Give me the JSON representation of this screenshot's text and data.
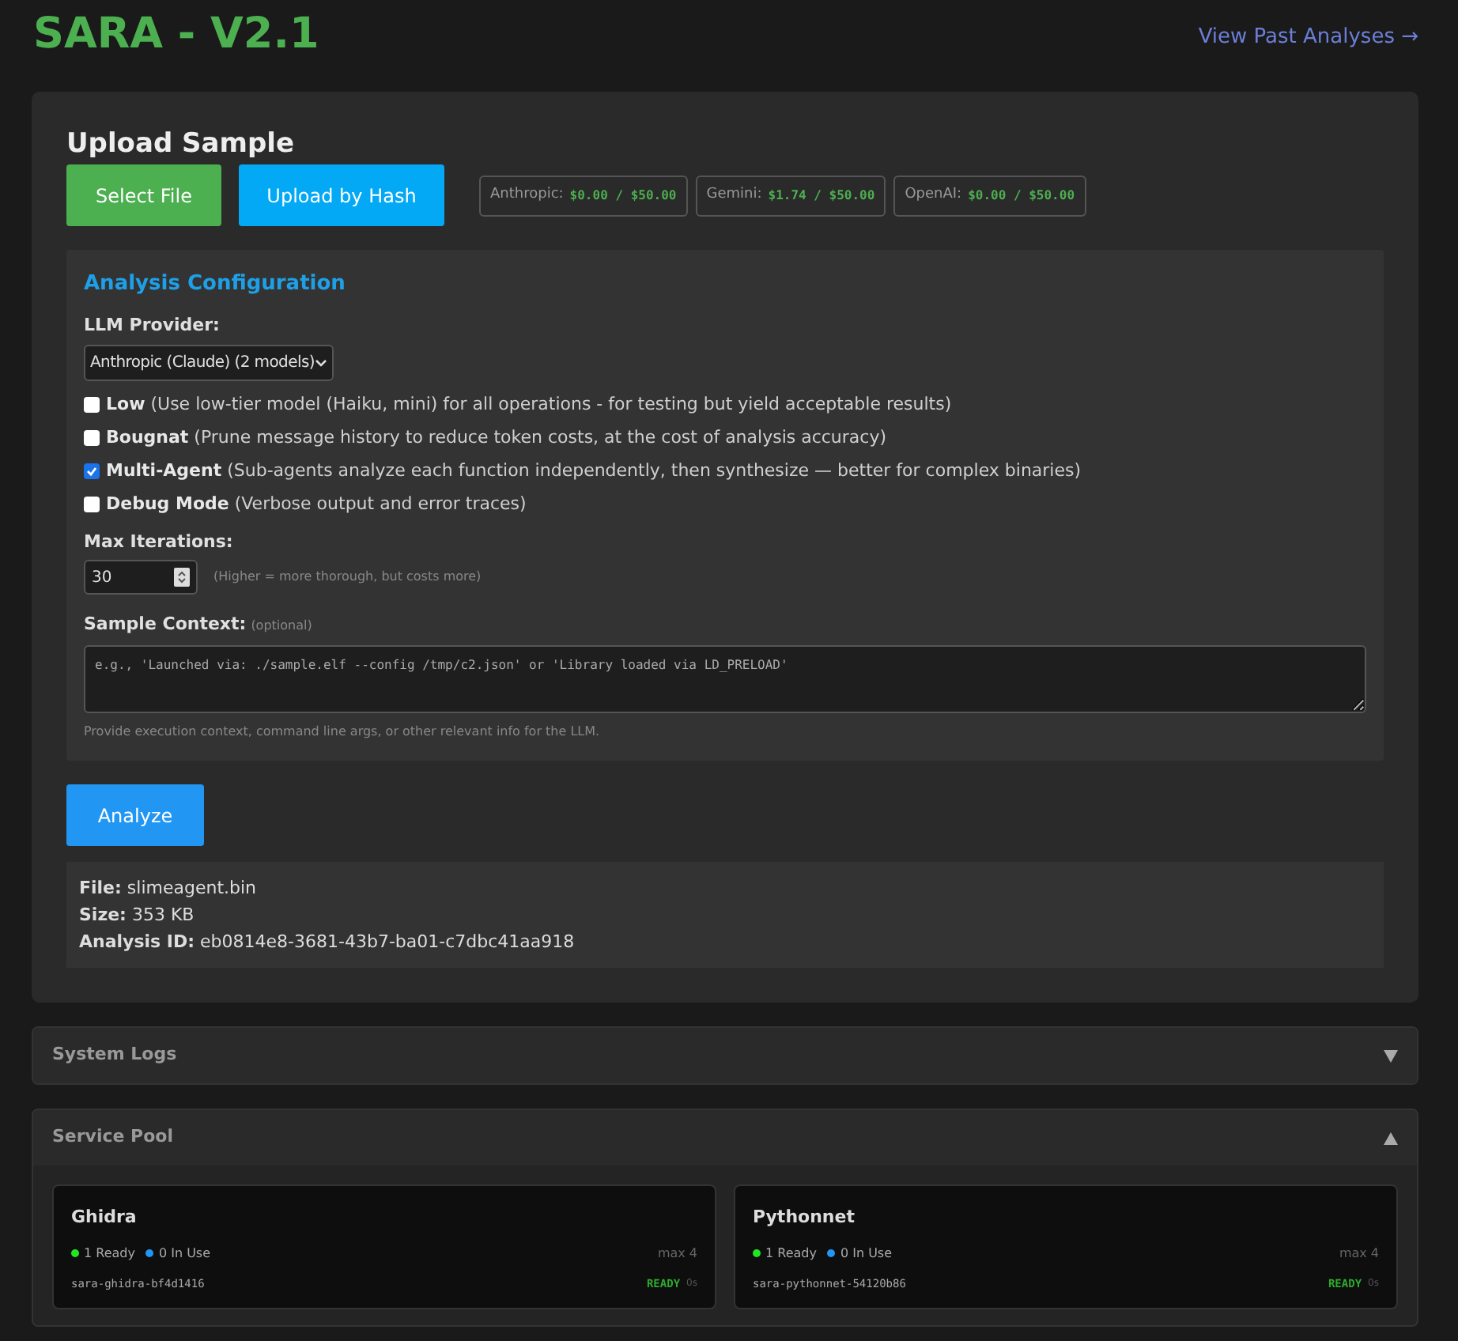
{
  "header": {
    "title": "SARA - V2.1",
    "link": "View Past Analyses →"
  },
  "upload": {
    "title": "Upload Sample",
    "buttons": [
      {
        "label": "Select File",
        "color": "#4caf50"
      },
      {
        "label": "Upload by Hash",
        "color": "#03a9f4"
      }
    ],
    "budgets": [
      {
        "provider": "Anthropic:",
        "amount": "$0.00 / $50.00"
      },
      {
        "provider": "Gemini:",
        "amount": "$1.74 / $50.00"
      },
      {
        "provider": "OpenAI:",
        "amount": "$0.00 / $50.00"
      }
    ]
  },
  "config": {
    "title": "Analysis Configuration",
    "provider_label": "LLM Provider:",
    "provider_value": "Anthropic (Claude) (2 models)",
    "options": [
      {
        "label": "Low",
        "description": "(Use low-tier model (Haiku, mini) for all operations - for testing but yield acceptable results)",
        "checked": false
      },
      {
        "label": "Bougnat",
        "description": "(Prune message history to reduce token costs, at the cost of analysis accuracy)",
        "checked": false
      },
      {
        "label": "Multi-Agent",
        "description": "(Sub-agents analyze each function independently, then synthesize — better for complex binaries)",
        "checked": true
      },
      {
        "label": "Debug Mode",
        "description": "(Verbose output and error traces)",
        "checked": false
      }
    ],
    "iterations_label": "Max Iterations:",
    "iterations_value": "30",
    "iterations_hint": "(Higher = more thorough, but costs more)",
    "context_label": "Sample Context:",
    "context_optional": "(optional)",
    "context_placeholder": "e.g., 'Launched via: ./sample.elf --config /tmp/c2.json' or 'Library loaded via LD_PRELOAD'",
    "context_help": "Provide execution context, command line args, or other relevant info for the LLM."
  },
  "analyze_button": "Analyze",
  "file_info": [
    {
      "label": "File:",
      "value": "slimeagent.bin"
    },
    {
      "label": "Size:",
      "value": "353 KB"
    },
    {
      "label": "Analysis ID:",
      "value": "eb0814e8-3681-43b7-ba01-c7dbc41aa918"
    }
  ],
  "panels": [
    {
      "title": "System Logs",
      "expanded": false
    },
    {
      "title": "Service Pool",
      "expanded": true
    }
  ],
  "services": [
    {
      "name": "Ghidra",
      "ready": "1 Ready",
      "in_use": "0 In Use",
      "max": "max 4",
      "instance": "sara-ghidra-bf4d1416",
      "status": "READY",
      "age": "0s"
    },
    {
      "name": "Pythonnet",
      "ready": "1 Ready",
      "in_use": "0 In Use",
      "max": "max 4",
      "instance": "sara-pythonnet-54120b86",
      "status": "READY",
      "age": "0s"
    }
  ]
}
